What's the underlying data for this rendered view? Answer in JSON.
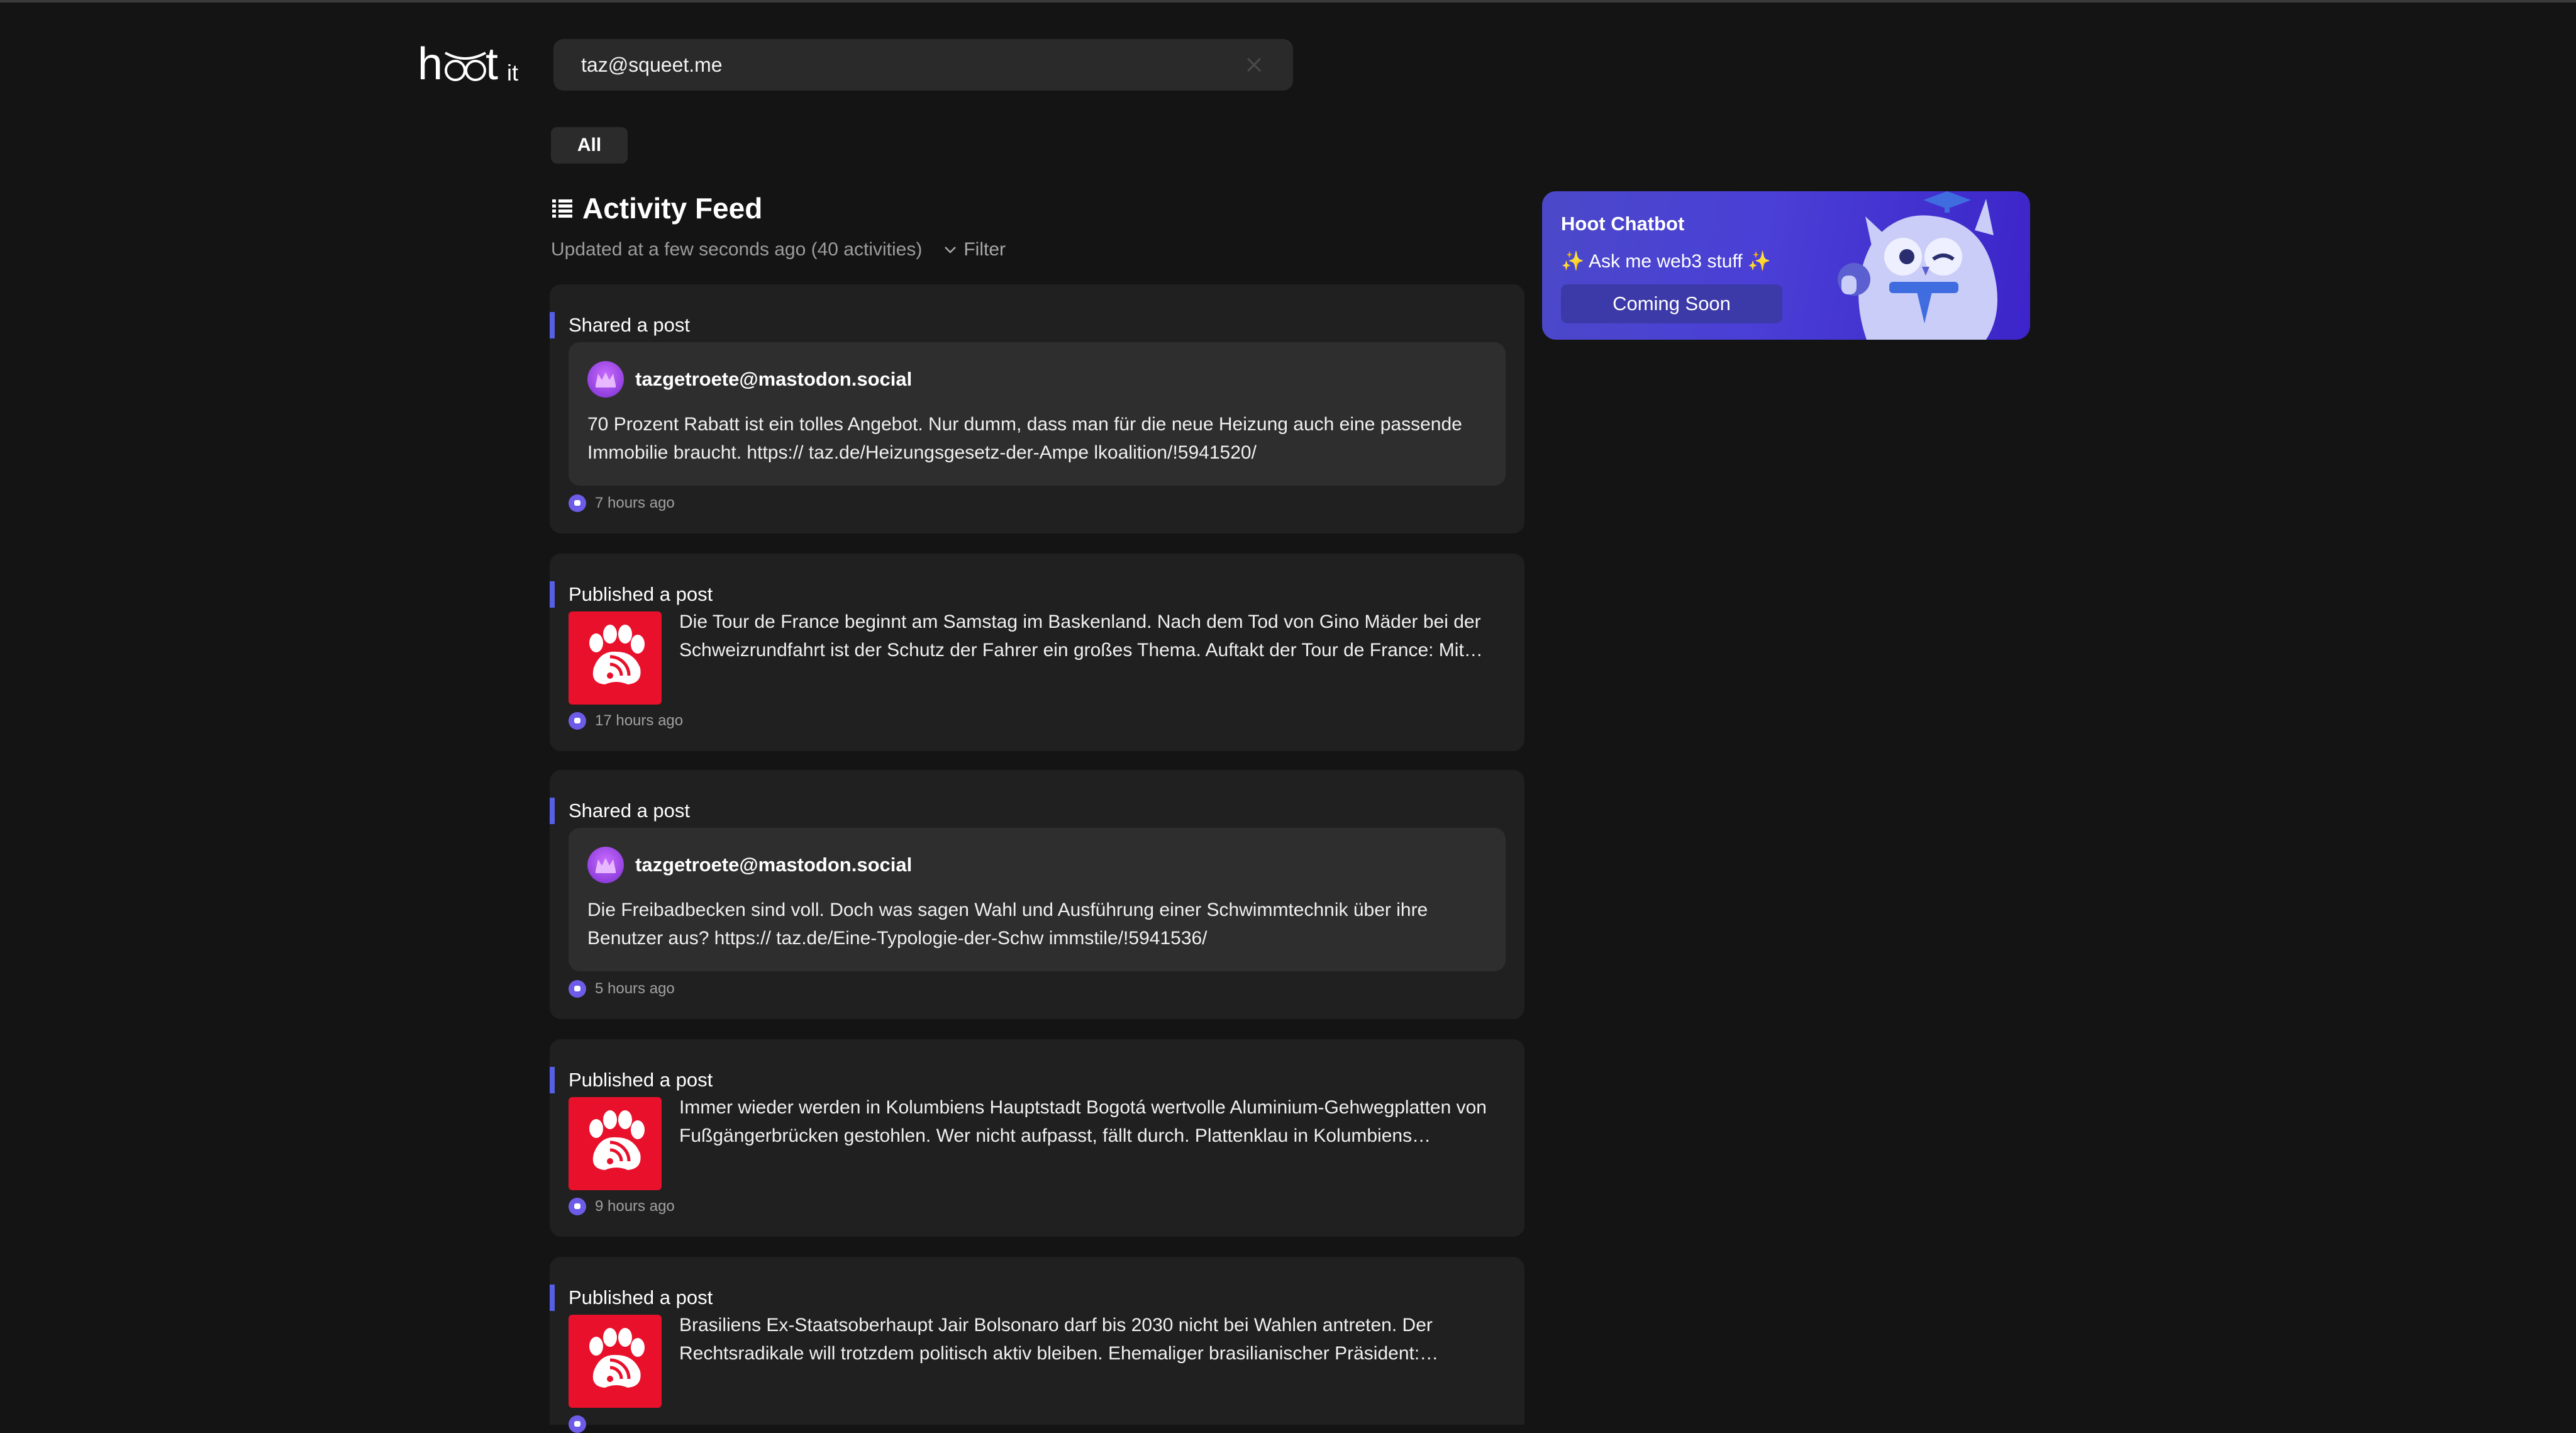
{
  "header": {
    "logo_text": "hootit",
    "search": {
      "value": "taz@squeet.me",
      "placeholder": ""
    }
  },
  "filters": {
    "chip_label": "All"
  },
  "feed": {
    "title": "Activity Feed",
    "updated_text": "Updated at a few seconds ago (40 activities)",
    "filter_label": "Filter",
    "items": [
      {
        "kind": "Shared a post",
        "author": "tazgetroete@mastodon.social",
        "text": "70 Prozent Rabatt ist ein tolles Angebot. Nur dumm, dass man für die neue Heizung auch eine passende Immobilie braucht. https:// taz.de/Heizungsgesetz-der-Ampe lkoalition/!5941520/",
        "time": "7 hours ago"
      },
      {
        "kind": "Published a post",
        "text": "Die Tour de France beginnt am Samstag im Baskenland. Nach dem Tod von Gino Mäder bei der Schweizrundfahrt ist der Schutz der Fahrer ein großes Thema. Auftakt der Tour de France: Mit…",
        "time": "17 hours ago"
      },
      {
        "kind": "Shared a post",
        "author": "tazgetroete@mastodon.social",
        "text": "Die Freibadbecken sind voll. Doch was sagen Wahl und Ausführung einer Schwimmtechnik über ihre Benutzer aus? https:// taz.de/Eine-Typologie-der-Schw immstile/!5941536/",
        "time": "5 hours ago"
      },
      {
        "kind": "Published a post",
        "text": "Immer wieder werden in Kolumbiens Hauptstadt Bogotá wertvolle Aluminium-Gehwegplatten von Fußgängerbrücken gestohlen. Wer nicht aufpasst, fällt durch. Plattenklau in Kolumbiens…",
        "time": "9 hours ago"
      },
      {
        "kind": "Published a post",
        "text": "Brasiliens Ex-Staatsoberhaupt Jair Bolsonaro darf bis 2030 nicht bei Wahlen antreten. Der Rechtsradikale will trotzdem politisch aktiv bleiben. Ehemaliger brasilianischer Präsident:…",
        "time": ""
      }
    ]
  },
  "chatbot": {
    "title": "Hoot Chatbot",
    "subtitle": "✨ Ask me web3 stuff ✨",
    "button_label": "Coming Soon"
  },
  "colors": {
    "background": "#151414",
    "card": "#202020",
    "inner_card": "#2e2e2e",
    "accent_bar": "#5560e6",
    "thumb_red": "#e8102a",
    "chatbot_bg": "#4a3fd6"
  },
  "icons": {
    "list": "list-icon",
    "chevron": "chevron-down-icon",
    "clear": "close-icon",
    "platform": "mastodon-icon",
    "thumb": "taz-paw-rss-icon"
  }
}
